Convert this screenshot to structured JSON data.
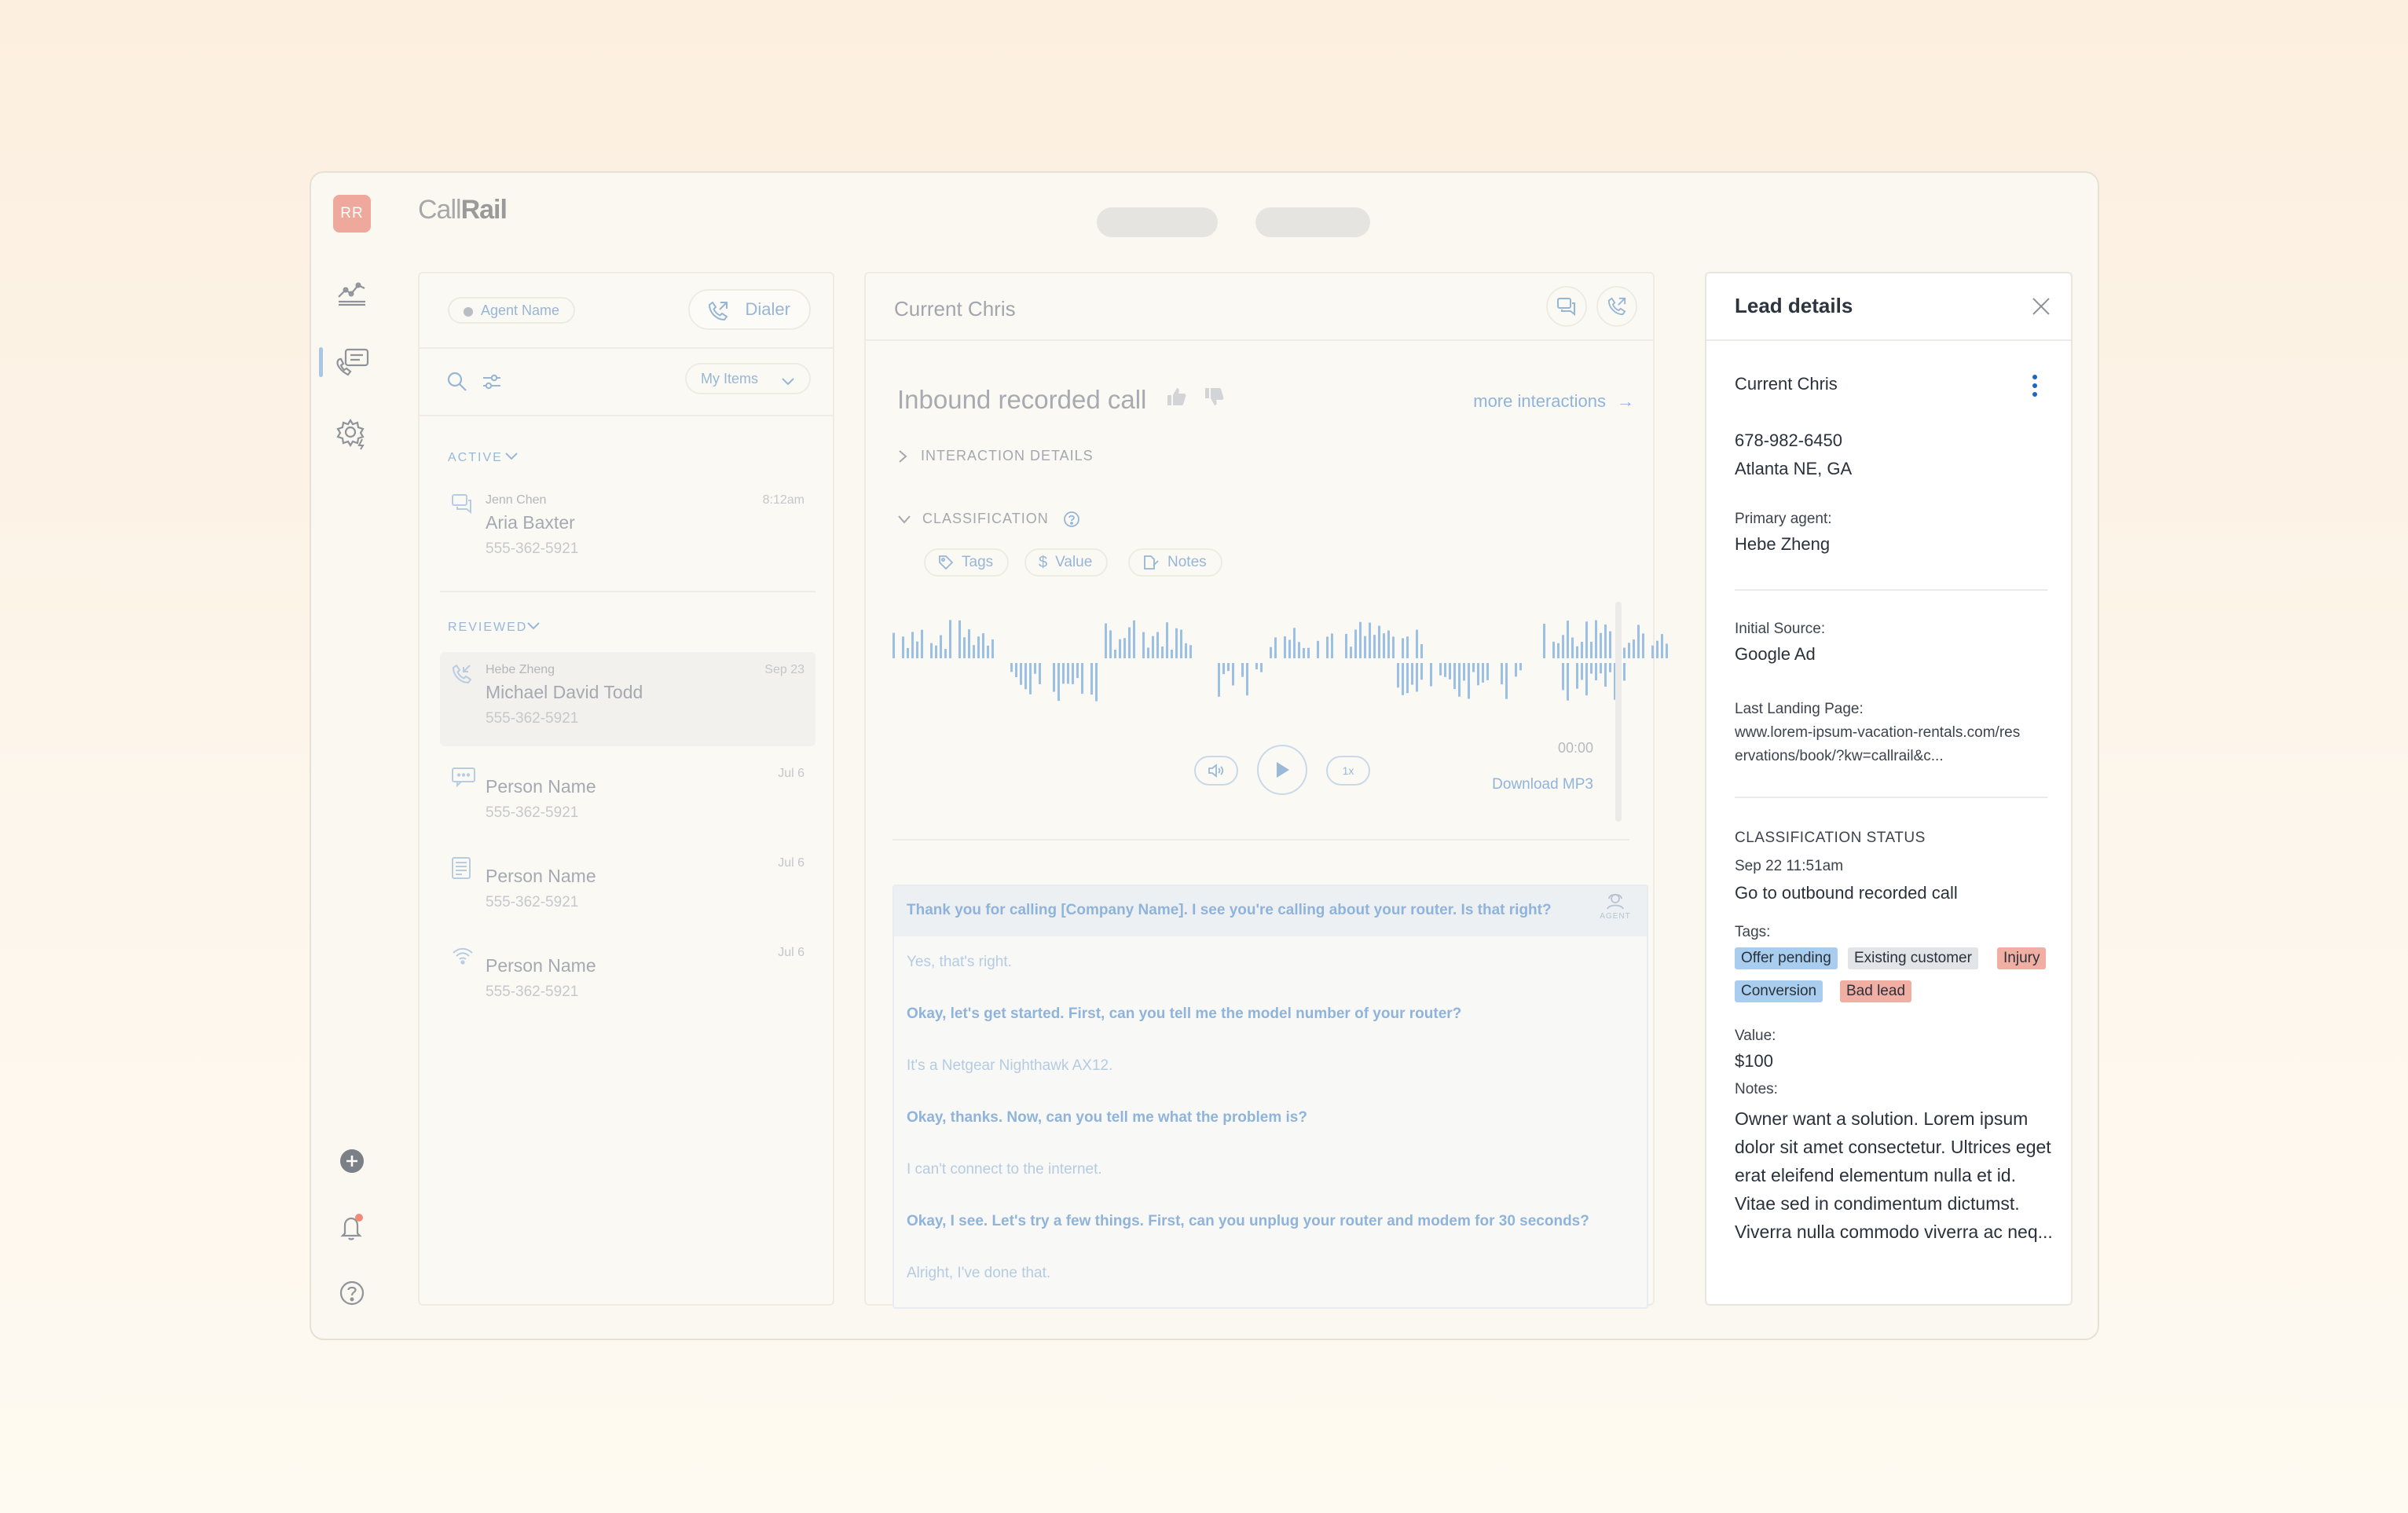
{
  "app": {
    "avatar_initials": "RR",
    "logo_call": "Call",
    "logo_rail": "Rail"
  },
  "colors": {
    "accent_blue": "#1b66c9",
    "avatar_bg": "#efa89c",
    "tag_blue": "#a9cdee",
    "tag_gray": "#e2e4e7",
    "tag_red": "#f1aea3"
  },
  "rail": {
    "icons": [
      "analytics-icon",
      "conversations-icon",
      "settings-icon",
      "add-icon",
      "notifications-icon",
      "help-icon"
    ]
  },
  "list": {
    "agent_name": "Agent Name",
    "dialer_label": "Dialer",
    "filter_label": "My Items",
    "sections": {
      "active": "ACTIVE",
      "reviewed": "REVIEWED"
    },
    "active_items": [
      {
        "agent": "Jenn Chen",
        "name": "Aria Baxter",
        "phone": "555-362-5921",
        "date": "8:12am"
      }
    ],
    "reviewed_items": [
      {
        "agent": "Hebe Zheng",
        "name": "Michael David Todd",
        "phone": "555-362-5921",
        "date": "Sep 23"
      },
      {
        "agent": "",
        "name": "Person Name",
        "phone": "555-362-5921",
        "date": "Jul 6"
      },
      {
        "agent": "",
        "name": "Person Name",
        "phone": "555-362-5921",
        "date": "Jul 6"
      },
      {
        "agent": "",
        "name": "Person Name",
        "phone": "555-362-5921",
        "date": "Jul 6"
      }
    ]
  },
  "call": {
    "header_title": "Current Chris",
    "title": "Inbound recorded call",
    "more_interactions": "more interactions",
    "more_arrow": "→",
    "interaction_details": "INTERACTION DETAILS",
    "classification": "CLASSIFICATION",
    "chips": {
      "tags": "Tags",
      "value": "Value",
      "notes": "Notes"
    },
    "time": "00:00",
    "speed": "1x",
    "download": "Download MP3",
    "transcript_badge": "AGENT",
    "transcript": [
      {
        "speaker": "agent",
        "text": "Thank you for calling [Company Name].  I see you're calling about your router. Is that right?"
      },
      {
        "speaker": "caller",
        "text": "Yes, that's right."
      },
      {
        "speaker": "agent",
        "text": "Okay, let's get started. First, can you tell me the model number of your router?"
      },
      {
        "speaker": "caller",
        "text": "It's a Netgear Nighthawk AX12."
      },
      {
        "speaker": "agent",
        "text": " Okay, thanks. Now, can you tell me what the problem is?"
      },
      {
        "speaker": "caller",
        "text": "I can't connect to the internet."
      },
      {
        "speaker": "agent",
        "text": "Okay, I see. Let's try a few things. First, can you unplug your router and modem for 30 seconds?"
      },
      {
        "speaker": "caller",
        "text": "Alright, I've done that."
      }
    ]
  },
  "lead": {
    "title": "Lead details",
    "name": "Current Chris",
    "phone": "678-982-6450",
    "location": "Atlanta NE, GA",
    "primary_agent_label": "Primary agent:",
    "primary_agent": "Hebe Zheng",
    "initial_source_label": "Initial Source:",
    "initial_source": "Google Ad",
    "landing_label": "Last Landing Page:",
    "landing_line1": "www.lorem-ipsum-vacation-rentals.com/res",
    "landing_line2": "ervations/book/?kw=callrail&c...",
    "status_label": "CLASSIFICATION STATUS",
    "status_date": "Sep 22 11:51am",
    "status_link": "Go to outbound recorded call",
    "tags_label": "Tags:",
    "tags": [
      "Offer pending",
      "Existing customer",
      "Injury",
      "Conversion",
      "Bad lead"
    ],
    "value_label": "Value:",
    "value": "$100",
    "notes_label": "Notes:",
    "notes": "Owner want a solution. Lorem ipsum dolor sit amet consectetur. Ultrices eget erat eleifend elementum nulla et id. Vitae sed in condimentum dictumst. Viverra nulla commodo viverra ac neq..."
  }
}
